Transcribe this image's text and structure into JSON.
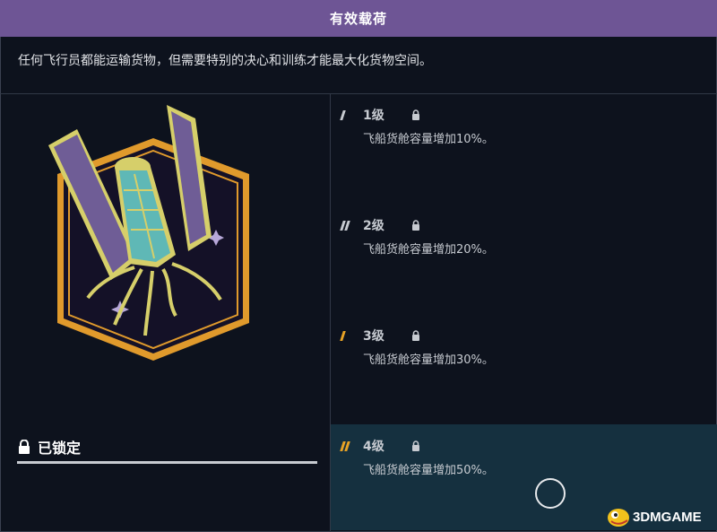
{
  "header": {
    "title": "有效载荷"
  },
  "description": "任何飞行员都能运输货物，但需要特别的决心和训练才能最大化货物空间。",
  "status": {
    "label": "已锁定",
    "icon": "lock-icon"
  },
  "levels": [
    {
      "label": "1级",
      "desc": "飞船货舱容量增加10%。",
      "pips_filled": 1,
      "pip_color": "#c7cbd1"
    },
    {
      "label": "2级",
      "desc": "飞船货舱容量增加20%。",
      "pips_filled": 2,
      "pip_color": "#c7cbd1"
    },
    {
      "label": "3级",
      "desc": "飞船货舱容量增加30%。",
      "pips_filled": 1,
      "pip_color": "#e8a325"
    },
    {
      "label": "4级",
      "desc": "飞船货舱容量增加50%。",
      "pips_filled": 2,
      "pip_color": "#e8a325"
    }
  ],
  "watermark": {
    "text": "3DMGAME"
  },
  "colors": {
    "header_bg": "#6e5595",
    "background": "#0d121d",
    "active_level_bg": "#15303f",
    "accent": "#e8a325"
  }
}
